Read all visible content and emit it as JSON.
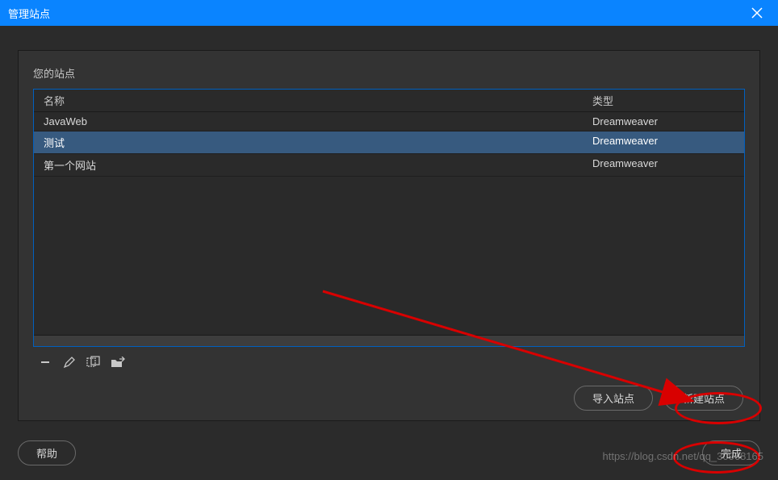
{
  "titlebar": {
    "title": "管理站点"
  },
  "panel": {
    "heading": "您的站点",
    "columns": {
      "name": "名称",
      "type": "类型"
    },
    "rows": [
      {
        "name": "JavaWeb",
        "type": "Dreamweaver",
        "selected": false
      },
      {
        "name": "测试",
        "type": "Dreamweaver",
        "selected": true
      },
      {
        "name": "第一个网站",
        "type": "Dreamweaver",
        "selected": false
      }
    ]
  },
  "toolbar_icons": {
    "remove": "remove-icon",
    "edit": "edit-icon",
    "duplicate": "duplicate-icon",
    "export": "export-icon"
  },
  "buttons": {
    "import": "导入站点",
    "new": "新建站点",
    "help": "帮助",
    "done": "完成"
  },
  "watermark": "https://blog.csdn.net/qq_30068165"
}
